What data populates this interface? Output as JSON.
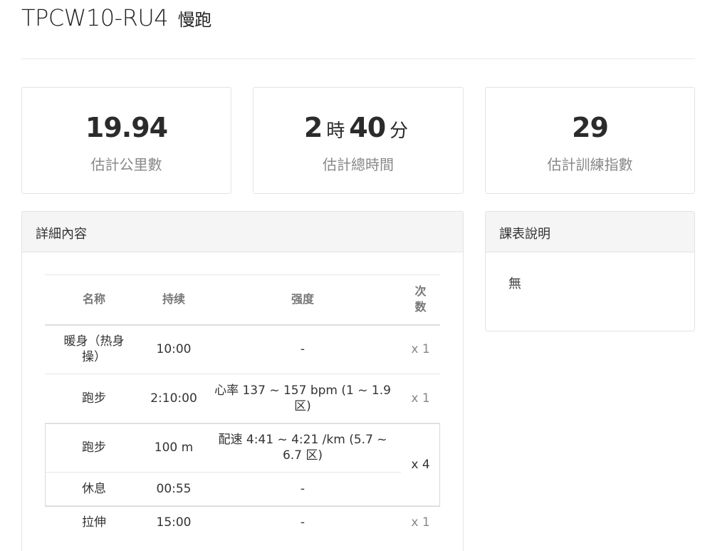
{
  "header": {
    "code": "TPCW10-RU4",
    "subtitle": "慢跑"
  },
  "stats": [
    {
      "value": "19.94",
      "label": "估計公里數"
    },
    {
      "hours": "2",
      "hours_unit": "時",
      "minutes": "40",
      "minutes_unit": "分",
      "label": "估計總時間"
    },
    {
      "value": "29",
      "label": "估計訓練指數"
    }
  ],
  "details": {
    "title": "詳細內容",
    "columns": {
      "name": "名称",
      "duration": "持续",
      "intensity": "强度",
      "count_l1": "次",
      "count_l2": "数"
    },
    "rows": [
      {
        "name": "暖身（热身操）",
        "duration": "10:00",
        "intensity": "-",
        "count": "x 1"
      },
      {
        "name": "跑步",
        "duration": "2:10:00",
        "intensity": "心率 137 ~ 157 bpm (1 ~ 1.9 区)",
        "count": "x 1"
      },
      {
        "name": "跑步",
        "duration": "100 m",
        "intensity": "配速 4:41 ~ 4:21 /km (5.7 ~ 6.7 区)",
        "count": "x 4"
      },
      {
        "name": "休息",
        "duration": "00:55",
        "intensity": "-"
      },
      {
        "name": "拉伸",
        "duration": "15:00",
        "intensity": "-",
        "count": "x 1"
      }
    ]
  },
  "description": {
    "title": "課表說明",
    "text": "無"
  }
}
